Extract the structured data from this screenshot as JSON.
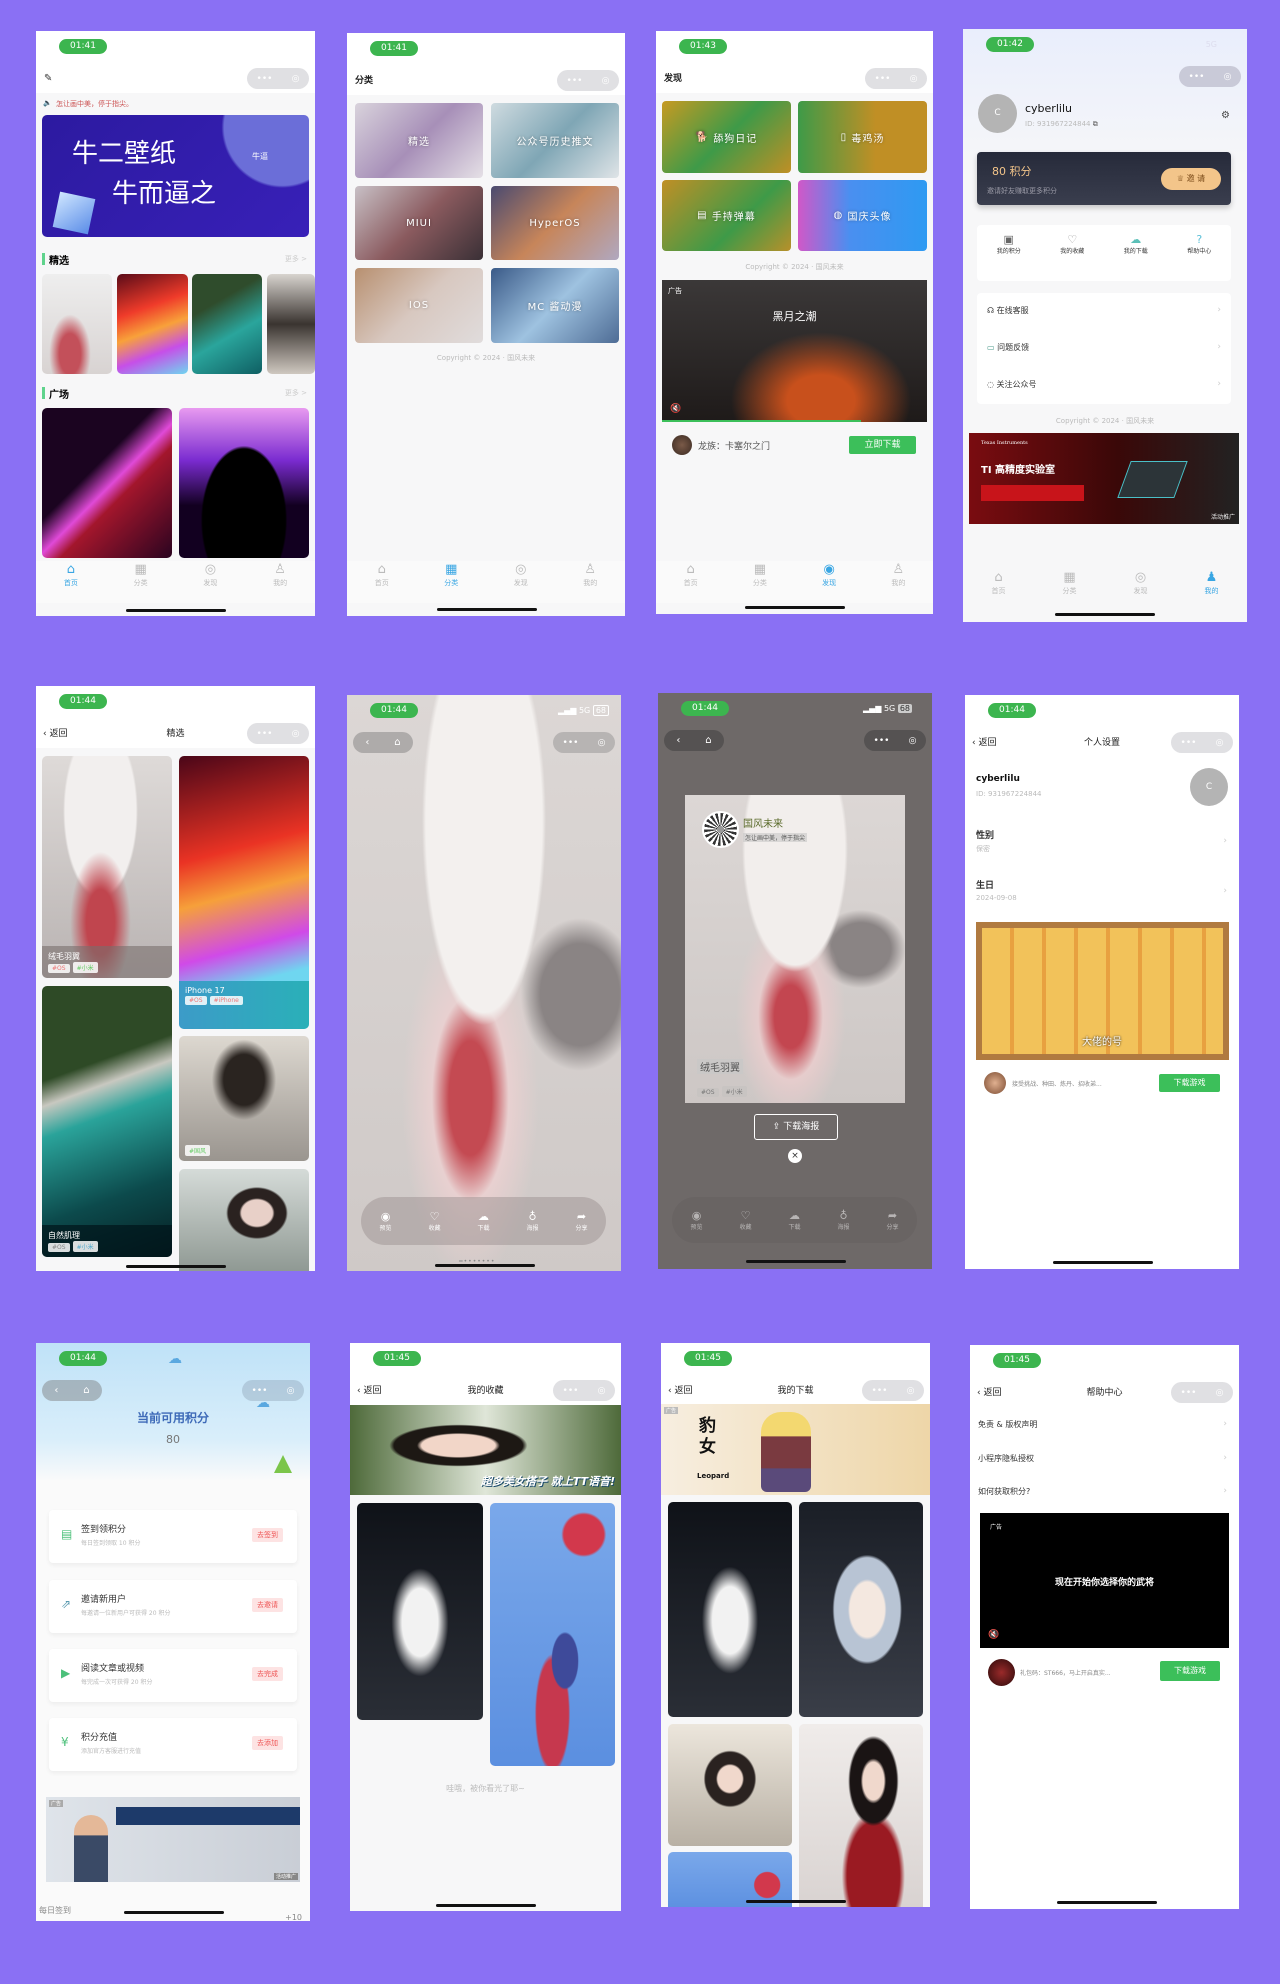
{
  "page": {
    "background": "#8a70f4",
    "accent_green": "#3cb54f",
    "accent_blue": "#39a6e3"
  },
  "tabbar": [
    "首页",
    "分类",
    "发现",
    "我的"
  ],
  "screens": {
    "home": {
      "time": "01:41",
      "notice": "怎让画中美，停于指尖。",
      "banner_line1": "牛二壁纸",
      "banner_line2": "牛而逼之",
      "banner_sign": "牛逼",
      "sections": [
        {
          "title": "精选",
          "more": "更多 >"
        },
        {
          "title": "广场",
          "more": "更多 >"
        }
      ]
    },
    "category": {
      "time": "01:41",
      "title": "分类",
      "tiles": [
        "精选",
        "公众号历史推文",
        "MIUI",
        "HyperOS",
        "IOS",
        "MC 酱动漫"
      ],
      "copyright": "Copyright © 2024 · 国风未来"
    },
    "discover": {
      "time": "01:43",
      "title": "发现",
      "tiles": [
        "舔狗日记",
        "毒鸡汤",
        "手持弹幕",
        "国庆头像"
      ],
      "copyright": "Copyright © 2024 · 国风未来",
      "ad": {
        "label": "广告",
        "video_title": "黑月之潮",
        "app_name": "龙族：卡塞尔之门",
        "cta": "立即下载",
        "progress": 0.75
      }
    },
    "profile": {
      "time": "01:42",
      "signal": "5G",
      "avatar_letter": "C",
      "username": "cyberlilu",
      "user_id": "ID: 931967224844",
      "points": "80 积分",
      "points_hint": "邀请好友赚取更多积分",
      "invite": "邀 请",
      "quick": [
        "我的积分",
        "我的收藏",
        "我的下载",
        "帮助中心"
      ],
      "menu": [
        "在线客服",
        "问题反馈",
        "关注公众号"
      ],
      "copyright": "Copyright © 2024 · 国风未来",
      "ad": {
        "label": "广告",
        "brand": "Texas Instruments",
        "title": "TI 高精度实验室",
        "tag": "活动推广"
      }
    },
    "featured": {
      "time": "01:44",
      "back": "返回",
      "title": "精选",
      "cards": [
        {
          "title": "绒毛羽翼",
          "tags": [
            "#OS",
            "#小米"
          ]
        },
        {
          "title": "iPhone 17",
          "tags": [
            "#OS",
            "#iPhone"
          ]
        },
        {
          "title": "",
          "tags": [
            "#国风"
          ]
        },
        {
          "title": "自然肌理",
          "tags": [
            "#OS",
            "#小米"
          ]
        }
      ]
    },
    "detail": {
      "time": "01:44",
      "signal": "5G",
      "battery": "68",
      "actions": [
        "预览",
        "收藏",
        "下载",
        "海报",
        "分享"
      ]
    },
    "poster": {
      "time": "01:44",
      "signal": "5G",
      "battery": "68",
      "brand": "国风未来",
      "slogan": "怎让画中美，停于指尖",
      "title": "绒毛羽翼",
      "tags": [
        "#OS",
        "#小米"
      ],
      "download": "下载海报",
      "actions": [
        "预览",
        "收藏",
        "下载",
        "海报",
        "分享"
      ]
    },
    "settings": {
      "time": "01:44",
      "back": "返回",
      "title": "个人设置",
      "username": "cyberlilu",
      "user_id": "ID: 931967224844",
      "avatar_letter": "C",
      "fields": [
        {
          "label": "性别",
          "value": "保密"
        },
        {
          "label": "生日",
          "value": "2024-09-08"
        }
      ],
      "ad": {
        "overlay": "大佬的号",
        "desc": "接受挑战、种田、炼丹、招收弟...",
        "cta": "下载游戏"
      }
    },
    "points": {
      "time": "01:44",
      "title": "当前可用积分",
      "value": "80",
      "tasks": [
        {
          "title": "签到领积分",
          "desc": "每日签到领取 10 积分",
          "action": "去签到"
        },
        {
          "title": "邀请新用户",
          "desc": "每邀请一位新用户可获得 20 积分",
          "action": "去邀请"
        },
        {
          "title": "阅读文章或视频",
          "desc": "每完成一次可获得 20 积分",
          "action": "去完成"
        },
        {
          "title": "积分充值",
          "desc": "添加官方客服进行充值",
          "action": "去添加"
        }
      ],
      "ad_label": "广告",
      "ad_tag": "活动推广",
      "footer": "每日签到",
      "footer_value": "+10"
    },
    "favorites": {
      "time": "01:45",
      "back": "返回",
      "title": "我的收藏",
      "ad_text": "超多美女搭子 就上TT语音!",
      "end_text": "哇哦，被你看光了耶~"
    },
    "downloads": {
      "time": "01:45",
      "back": "返回",
      "title": "我的下载",
      "ad_label": "广告",
      "ad_title": "豹女",
      "ad_sub": "Leopard"
    },
    "help": {
      "time": "01:45",
      "back": "返回",
      "title": "帮助中心",
      "items": [
        "免责 & 版权声明",
        "小程序隐私授权",
        "如何获取积分?"
      ],
      "ad_label": "广告",
      "ad_text": "现在开始你选择你的武将",
      "ad_desc": "礼包码：ST666，马上开启真实...",
      "cta": "下载游戏"
    }
  }
}
